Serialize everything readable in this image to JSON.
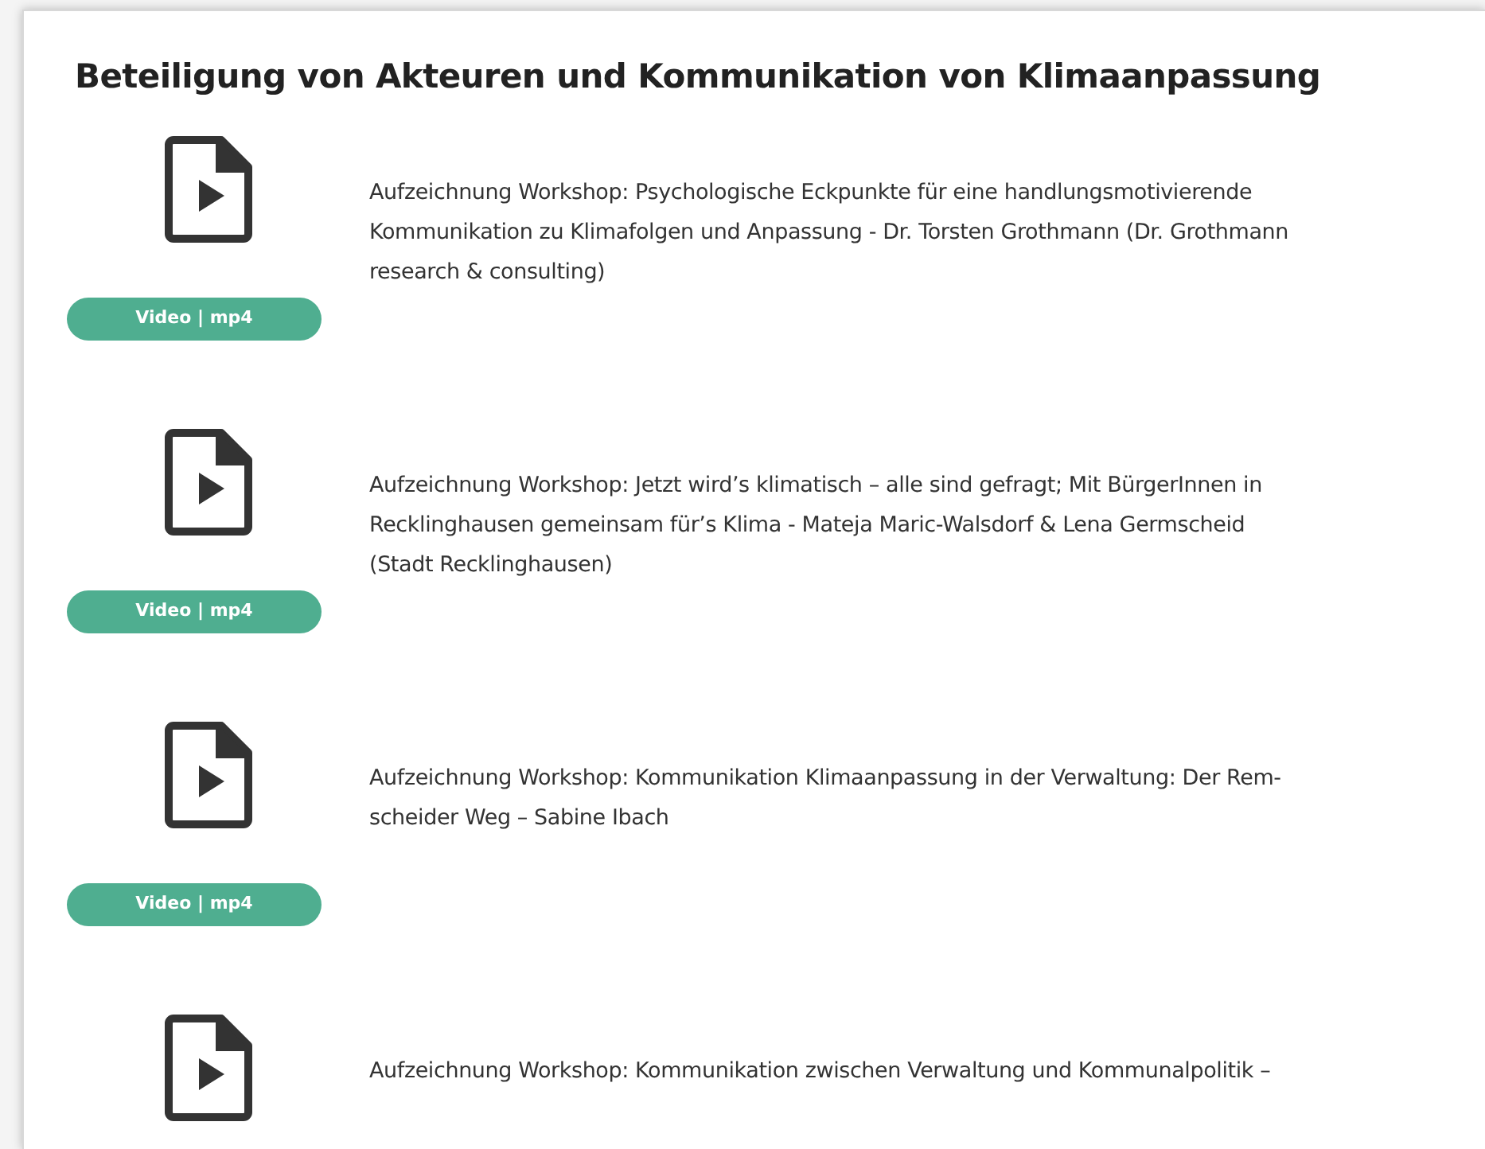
{
  "section": {
    "title": "Beteiligung von Akteuren und Kommunikation von Klimaanpassung"
  },
  "items": [
    {
      "lines": [
        "Aufzeichnung Workshop: Psychologische Eckpunkte für eine handlungsmotivierende",
        "Kommunikation zu Klimafolgen und Anpassung - Dr. Torsten Grothmann (Dr. Grothmann",
        "research & consulting)"
      ],
      "badge": "Video | mp4"
    },
    {
      "lines": [
        "Aufzeichnung Workshop: Jetzt wird’s klimatisch – alle sind gefragt; Mit BürgerInnen in",
        "Recklinghausen gemeinsam für’s Klima - Mateja Maric-Walsdorf & Lena Germscheid",
        "(Stadt Recklinghausen)"
      ],
      "badge": "Video | mp4"
    },
    {
      "lines": [
        "Aufzeichnung Workshop: Kommunikation Klimaanpassung in der Verwaltung: Der Rem-",
        "scheider Weg – Sabine Ibach"
      ],
      "badge": "Video | mp4"
    },
    {
      "lines": [
        "Aufzeichnung Workshop: Kommunikation zwischen Verwaltung und Kommunalpolitik –"
      ]
    }
  ]
}
